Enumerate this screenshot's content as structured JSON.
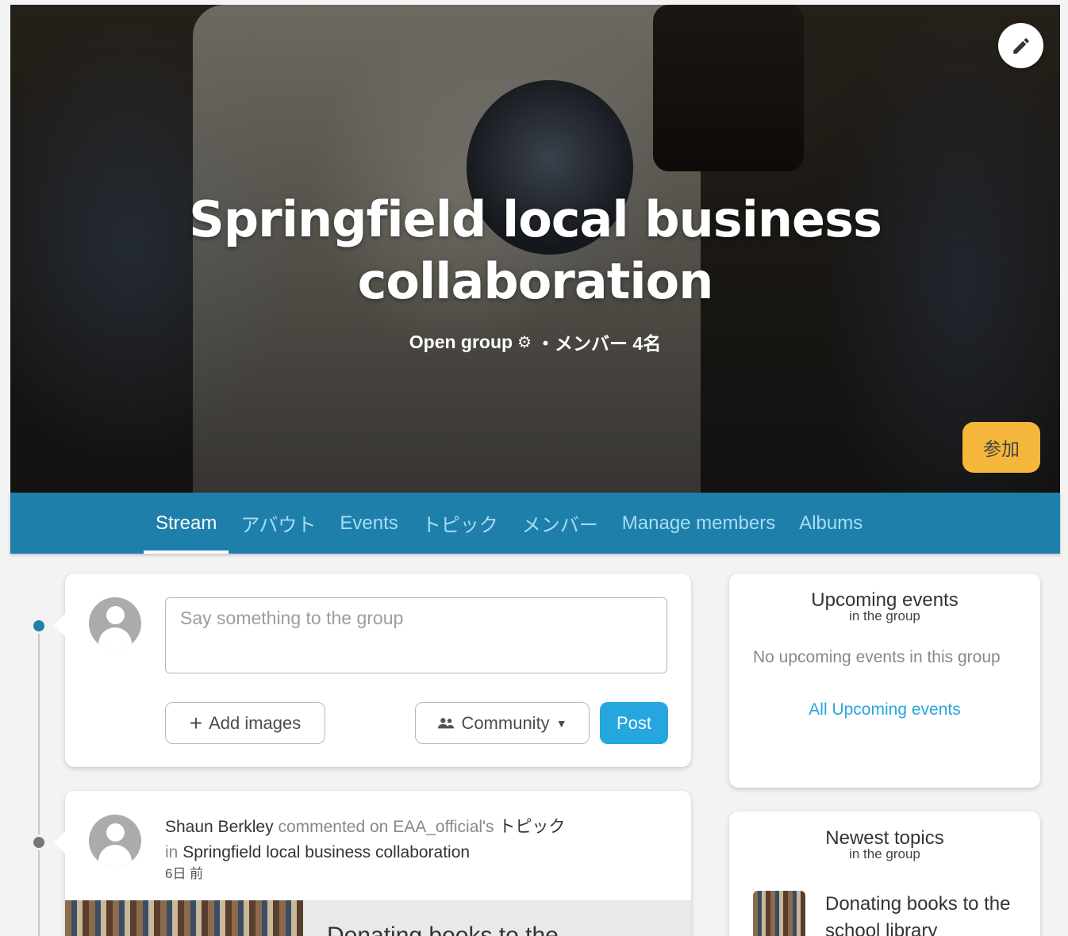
{
  "hero": {
    "title_line1": "Springfield local business",
    "title_line2": "collaboration",
    "group_type": "Open group",
    "members_text": "・メンバー 4名",
    "join_label": "参加"
  },
  "tabs": [
    {
      "label": "Stream",
      "active": true
    },
    {
      "label": "アバウト"
    },
    {
      "label": "Events"
    },
    {
      "label": "トピック"
    },
    {
      "label": "メンバー"
    },
    {
      "label": "Manage members"
    },
    {
      "label": "Albums"
    }
  ],
  "composer": {
    "placeholder": "Say something to the group",
    "add_images_label": "Add images",
    "visibility_label": "Community",
    "post_label": "Post"
  },
  "post": {
    "author": "Shaun Berkley",
    "action": "commented on",
    "owner": "EAA_official's",
    "target": "トピック",
    "in_word": "in",
    "group": "Springfield local business collaboration",
    "time": "6日 前",
    "preview_title": "Donating books to the"
  },
  "upcoming": {
    "title": "Upcoming events",
    "subtitle": "in the group",
    "empty_text": "No upcoming events in this group",
    "link": "All Upcoming events"
  },
  "newest": {
    "title": "Newest topics",
    "subtitle": "in the group",
    "topic_title": "Donating books to the school library"
  },
  "colors": {
    "nav_bg": "#1e7fab",
    "accent": "#26a6df",
    "join": "#f4b73b"
  }
}
